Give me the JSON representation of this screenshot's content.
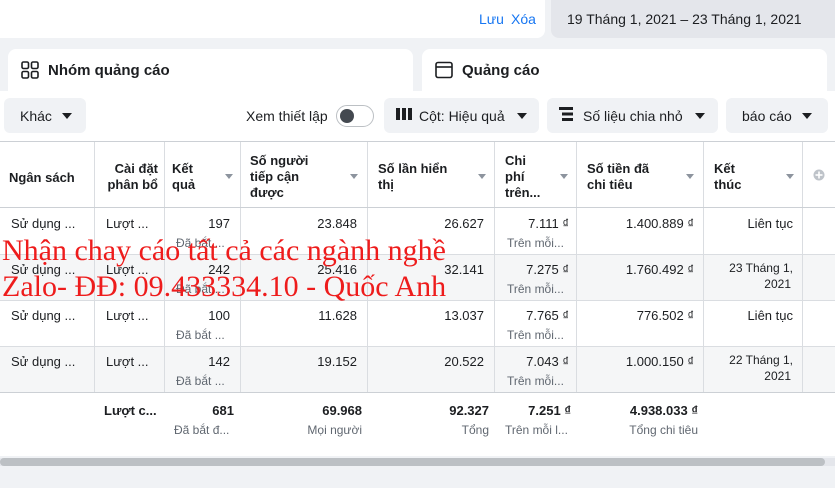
{
  "topbar": {
    "save_link": "Lưu",
    "clear_link": "Xóa",
    "date_range": "19 Tháng 1, 2021 – 23 Tháng 1, 2021"
  },
  "tabs": {
    "ad_sets": "Nhóm quảng cáo",
    "ads": "Quảng cáo"
  },
  "toolbar": {
    "more": "Khác",
    "view_setup": "Xem thiết lập",
    "columns": "Cột: Hiệu quả",
    "breakdown": "Số liệu chia nhỏ",
    "reports": "báo cáo"
  },
  "table": {
    "headers": {
      "budget": "Ngân sách",
      "attribution": [
        "Cài đặt",
        "phân bổ"
      ],
      "results": [
        "Kết",
        "quả"
      ],
      "reach": [
        "Số người",
        "tiếp cận",
        "được"
      ],
      "impressions": [
        "Số lần hiển",
        "thị"
      ],
      "cost": [
        "Chi",
        "phí",
        "trên..."
      ],
      "spent": [
        "Số tiền đã",
        "chi tiêu"
      ],
      "ends": [
        "Kết",
        "thúc"
      ]
    },
    "rows": [
      {
        "budget": "Sử dụng ...",
        "attribution": "Lượt ...",
        "results": "197",
        "results_sub": "Đã bắt ...",
        "reach": "23.848",
        "impressions": "26.627",
        "cost": "7.111 ₫",
        "cost_sub": "Trên mỗi...",
        "spent": "1.400.889 ₫",
        "ends": "Liên tục",
        "ends2": ""
      },
      {
        "budget": "Sử dụng ...",
        "attribution": "Lượt ...",
        "results": "242",
        "results_sub": "Đã bắt ...",
        "reach": "25.416",
        "impressions": "32.141",
        "cost": "7.275 ₫",
        "cost_sub": "Trên mỗi...",
        "spent": "1.760.492 ₫",
        "ends": "23 Tháng 1,",
        "ends2": "2021"
      },
      {
        "budget": "Sử dụng ...",
        "attribution": "Lượt ...",
        "results": "100",
        "results_sub": "Đã bắt ...",
        "reach": "11.628",
        "impressions": "13.037",
        "cost": "7.765 ₫",
        "cost_sub": "Trên mỗi...",
        "spent": "776.502 ₫",
        "ends": "Liên tục",
        "ends2": ""
      },
      {
        "budget": "Sử dụng ...",
        "attribution": "Lượt ...",
        "results": "142",
        "results_sub": "Đã bắt ...",
        "reach": "19.152",
        "impressions": "20.522",
        "cost": "7.043 ₫",
        "cost_sub": "Trên mỗi...",
        "spent": "1.000.150 ₫",
        "ends": "22 Tháng 1,",
        "ends2": "2021"
      }
    ],
    "totals": {
      "attribution": "Lượt c...",
      "results": "681",
      "results_sub": "Đã bắt đ...",
      "reach": "69.968",
      "reach_sub": "Mọi người",
      "impressions": "92.327",
      "impressions_sub": "Tổng",
      "cost": "7.251 ₫",
      "cost_sub": "Trên mỗi l...",
      "spent": "4.938.033 ₫",
      "spent_sub": "Tổng chi tiêu"
    }
  },
  "watermark": {
    "line1": "Nhận chay cáo tất cả các ngành nghề",
    "line2": "Zalo- ĐĐ: 09.433334.10 - Quốc Anh"
  },
  "colors": {
    "accent": "#1877f2",
    "watermark": "#ee1c1c"
  }
}
